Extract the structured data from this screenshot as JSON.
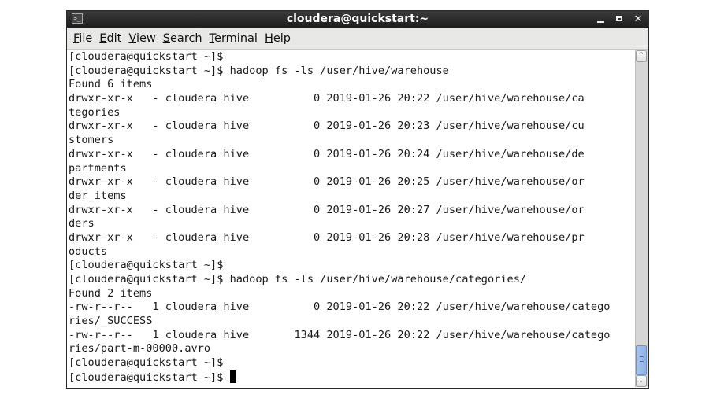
{
  "window": {
    "title": "cloudera@quickstart:~",
    "app_icon": "terminal-icon",
    "controls": {
      "minimize": "minimize-icon",
      "maximize": "maximize-icon",
      "close": "✕"
    }
  },
  "menubar": {
    "items": [
      {
        "mnemonic": "F",
        "rest": "ile"
      },
      {
        "mnemonic": "E",
        "rest": "dit"
      },
      {
        "mnemonic": "V",
        "rest": "iew"
      },
      {
        "mnemonic": "S",
        "rest": "earch"
      },
      {
        "mnemonic": "T",
        "rest": "erminal"
      },
      {
        "mnemonic": "H",
        "rest": "elp"
      }
    ]
  },
  "terminal": {
    "lines": [
      "[cloudera@quickstart ~]$",
      "[cloudera@quickstart ~]$ hadoop fs -ls /user/hive/warehouse",
      "Found 6 items",
      "drwxr-xr-x   - cloudera hive          0 2019-01-26 20:22 /user/hive/warehouse/ca",
      "tegories",
      "drwxr-xr-x   - cloudera hive          0 2019-01-26 20:23 /user/hive/warehouse/cu",
      "stomers",
      "drwxr-xr-x   - cloudera hive          0 2019-01-26 20:24 /user/hive/warehouse/de",
      "partments",
      "drwxr-xr-x   - cloudera hive          0 2019-01-26 20:25 /user/hive/warehouse/or",
      "der_items",
      "drwxr-xr-x   - cloudera hive          0 2019-01-26 20:27 /user/hive/warehouse/or",
      "ders",
      "drwxr-xr-x   - cloudera hive          0 2019-01-26 20:28 /user/hive/warehouse/pr",
      "oducts",
      "[cloudera@quickstart ~]$",
      "[cloudera@quickstart ~]$ hadoop fs -ls /user/hive/warehouse/categories/",
      "Found 2 items",
      "-rw-r--r--   1 cloudera hive          0 2019-01-26 20:22 /user/hive/warehouse/catego",
      "ries/_SUCCESS",
      "-rw-r--r--   1 cloudera hive       1344 2019-01-26 20:22 /user/hive/warehouse/catego",
      "ries/part-m-00000.avro",
      "[cloudera@quickstart ~]$",
      "[cloudera@quickstart ~]$ "
    ]
  },
  "scrollbar": {
    "up_arrow": "⌃",
    "down_arrow": "⌄",
    "position": 1.0
  }
}
